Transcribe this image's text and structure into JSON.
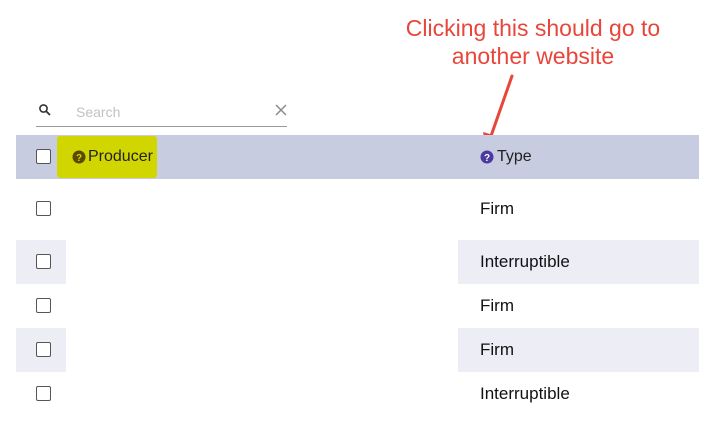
{
  "annotation": {
    "line1": "Clicking this should go to",
    "line2": "another website"
  },
  "search": {
    "placeholder": "Search",
    "value": ""
  },
  "header": {
    "producer_label": "Producer",
    "type_label": "Type"
  },
  "rows": [
    {
      "type": "Firm"
    },
    {
      "type": "Interruptible"
    },
    {
      "type": "Firm"
    },
    {
      "type": "Firm"
    },
    {
      "type": "Interruptible"
    }
  ],
  "colors": {
    "annotation": "#e8463a",
    "header_bg": "#c8cce0",
    "highlight": "#d2d600",
    "row_stripe": "#ededf6",
    "help_icon_type": "#4b3aa0",
    "help_icon_producer": "#5a4a00"
  },
  "icons": [
    "search-icon",
    "clear-icon",
    "help-icon",
    "checkbox"
  ]
}
